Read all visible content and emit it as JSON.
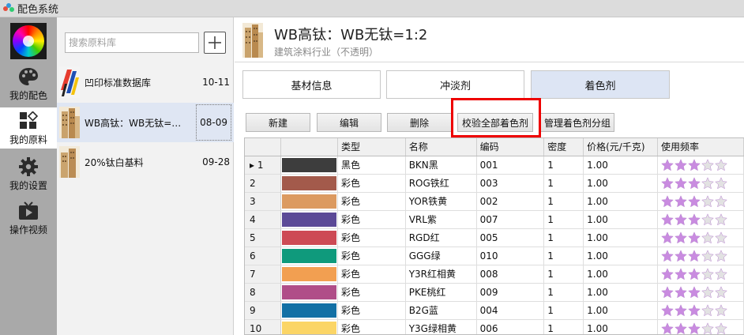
{
  "window": {
    "title": "配色系统"
  },
  "nav": {
    "items": [
      {
        "label": "我的配色",
        "icon": "palette-icon"
      },
      {
        "label": "我的原料",
        "icon": "grid-diamond-icon"
      },
      {
        "label": "我的设置",
        "icon": "gear-icon"
      },
      {
        "label": "操作视频",
        "icon": "tv-icon"
      }
    ],
    "active_index": 1
  },
  "library": {
    "search_placeholder": "搜索原料库",
    "items": [
      {
        "name": "凹印标准数据库",
        "date": "10-11"
      },
      {
        "name": "WB高钛：WB无钛=…",
        "date": "08-09"
      },
      {
        "name": "20%钛白基料",
        "date": "09-28"
      }
    ],
    "selected_index": 1
  },
  "header": {
    "title": "WB高钛：WB无钛=1:2",
    "subtitle": "建筑涂料行业（不透明）"
  },
  "tabs": [
    {
      "label": "基材信息"
    },
    {
      "label": "冲淡剂"
    },
    {
      "label": "着色剂"
    }
  ],
  "active_tab": 2,
  "toolbar": {
    "new_label": "新建",
    "edit_label": "编辑",
    "delete_label": "删除",
    "verify_label": "校验全部着色剂",
    "manage_label": "管理着色剂分组"
  },
  "table": {
    "columns": [
      "",
      "",
      "类型",
      "名称",
      "编码",
      "密度",
      "价格(元/千克)",
      "使用频率"
    ],
    "current_row_marker": "▸",
    "rows": [
      {
        "num": "1",
        "color": "#3d3d3d",
        "type": "黑色",
        "name": "BKN黑",
        "code": "001",
        "density": "1",
        "price": "1.00",
        "stars": 3
      },
      {
        "num": "2",
        "color": "#a35a4b",
        "type": "彩色",
        "name": "ROG铁红",
        "code": "003",
        "density": "1",
        "price": "1.00",
        "stars": 3
      },
      {
        "num": "3",
        "color": "#dc9a60",
        "type": "彩色",
        "name": "YOR铁黄",
        "code": "002",
        "density": "1",
        "price": "1.00",
        "stars": 3
      },
      {
        "num": "4",
        "color": "#5c4a97",
        "type": "彩色",
        "name": "VRL紫",
        "code": "007",
        "density": "1",
        "price": "1.00",
        "stars": 3
      },
      {
        "num": "5",
        "color": "#cd4a55",
        "type": "彩色",
        "name": "RGD红",
        "code": "005",
        "density": "1",
        "price": "1.00",
        "stars": 3
      },
      {
        "num": "6",
        "color": "#0f9a7c",
        "type": "彩色",
        "name": "GGG绿",
        "code": "010",
        "density": "1",
        "price": "1.00",
        "stars": 3
      },
      {
        "num": "7",
        "color": "#f29f51",
        "type": "彩色",
        "name": "Y3R红相黄",
        "code": "008",
        "density": "1",
        "price": "1.00",
        "stars": 3
      },
      {
        "num": "8",
        "color": "#b04e88",
        "type": "彩色",
        "name": "PKE桃红",
        "code": "009",
        "density": "1",
        "price": "1.00",
        "stars": 3
      },
      {
        "num": "9",
        "color": "#1270a5",
        "type": "彩色",
        "name": "B2G蓝",
        "code": "004",
        "density": "1",
        "price": "1.00",
        "stars": 3
      },
      {
        "num": "10",
        "color": "#fbd566",
        "type": "彩色",
        "name": "Y3G绿相黄",
        "code": "006",
        "density": "1",
        "price": "1.00",
        "stars": 3
      }
    ],
    "star_max": 5,
    "star_on_color": "#c98be0",
    "star_off_color": "#e2e2e2"
  }
}
